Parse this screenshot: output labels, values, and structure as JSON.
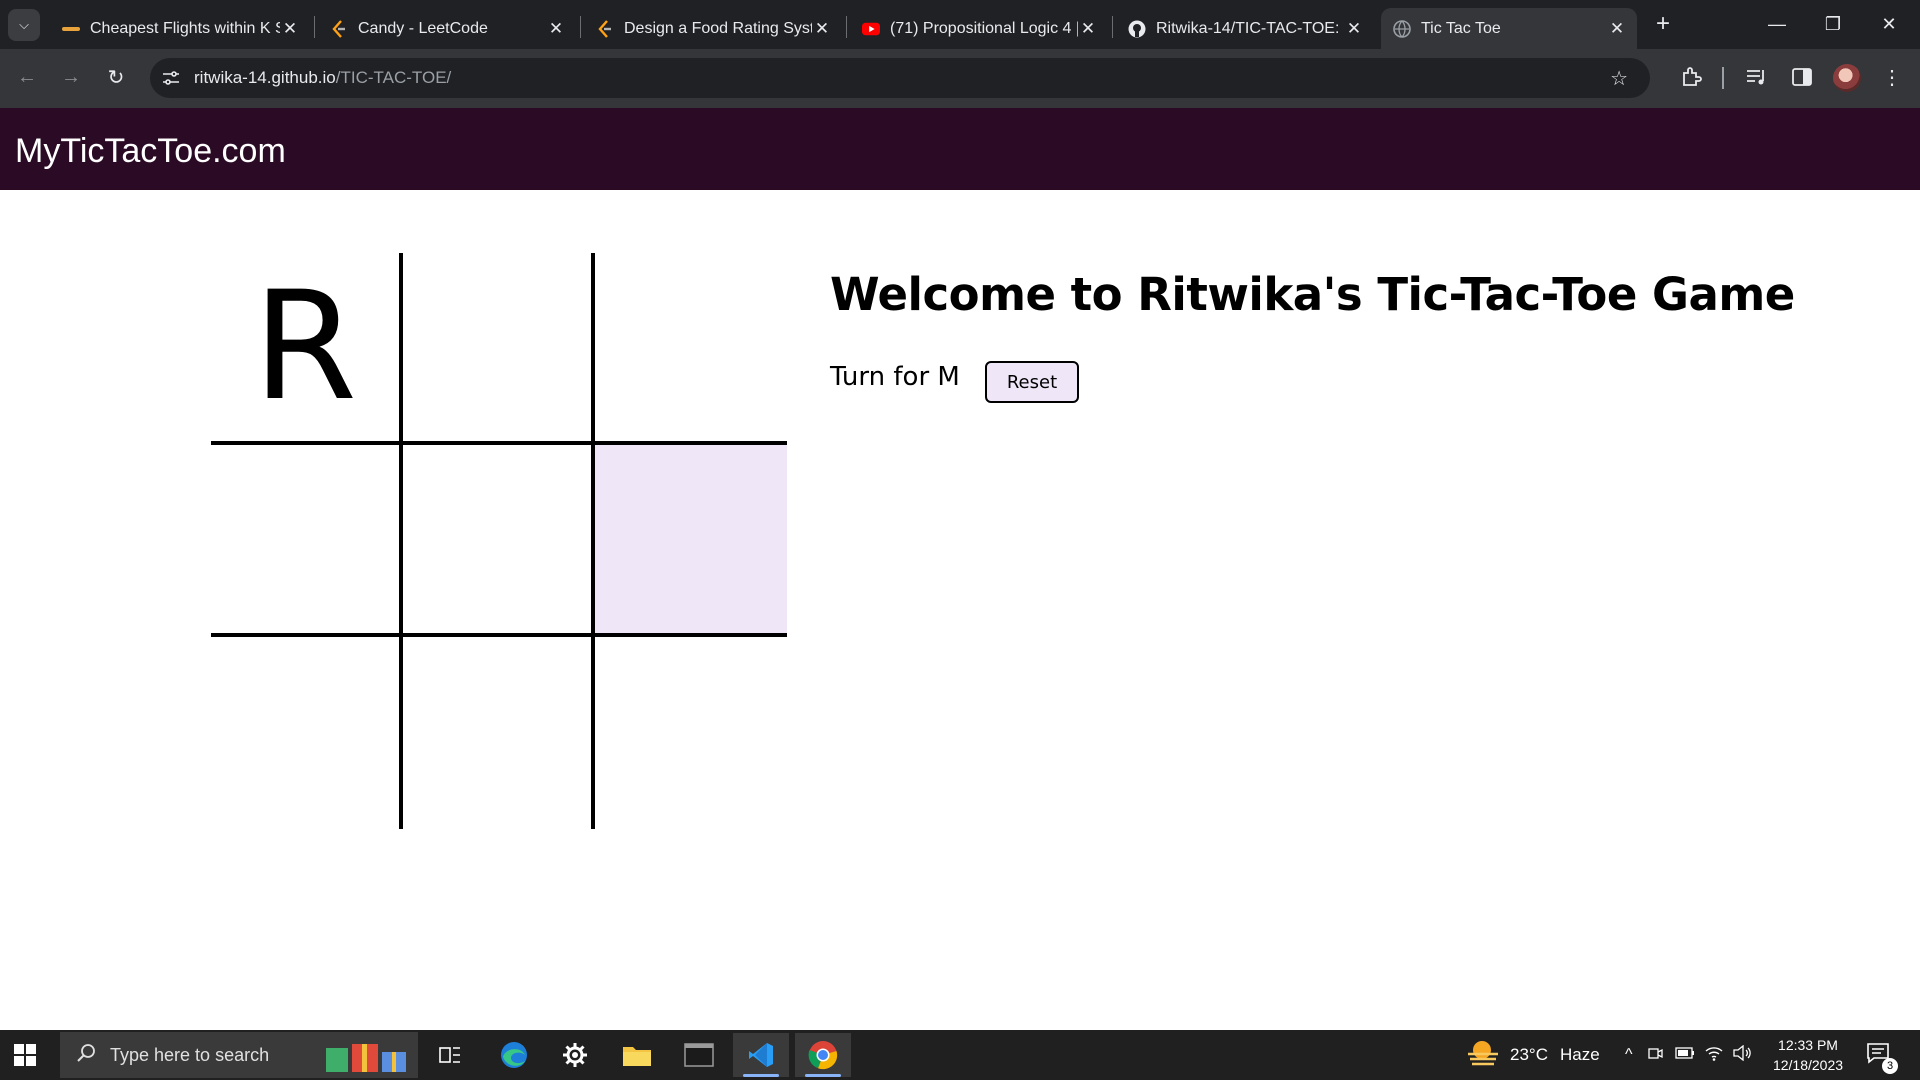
{
  "browser": {
    "tabs": [
      {
        "title": "Cheapest Flights within K S",
        "icon": "flights-favicon"
      },
      {
        "title": "Candy - LeetCode",
        "icon": "leetcode-icon"
      },
      {
        "title": "Design a Food Rating Syste",
        "icon": "leetcode-icon"
      },
      {
        "title": "(71) Propositional Logic 4 |",
        "icon": "youtube-icon"
      },
      {
        "title": "Ritwika-14/TIC-TAC-TOE: T",
        "icon": "github-icon"
      },
      {
        "title": "Tic Tac Toe",
        "icon": "globe-icon",
        "active": true
      }
    ],
    "address": {
      "host": "ritwika-14.github.io",
      "path": "/TIC-TAC-TOE/"
    }
  },
  "page": {
    "brand": "MyTicTacToe.com",
    "heading": "Welcome to Ritwika's Tic-Tac-Toe Game",
    "turn_text": "Turn for M",
    "reset_label": "Reset",
    "board": [
      "R",
      "",
      "",
      "",
      "",
      "",
      "",
      "",
      ""
    ],
    "highlight_cell": 5,
    "colors": {
      "nav_bg": "#2a0a24",
      "accent": "#efe6f8"
    }
  },
  "taskbar": {
    "search_placeholder": "Type here to search",
    "weather": {
      "temp": "23°C",
      "condition": "Haze"
    },
    "time": "12:33 PM",
    "date": "12/18/2023",
    "notifications": "3"
  }
}
